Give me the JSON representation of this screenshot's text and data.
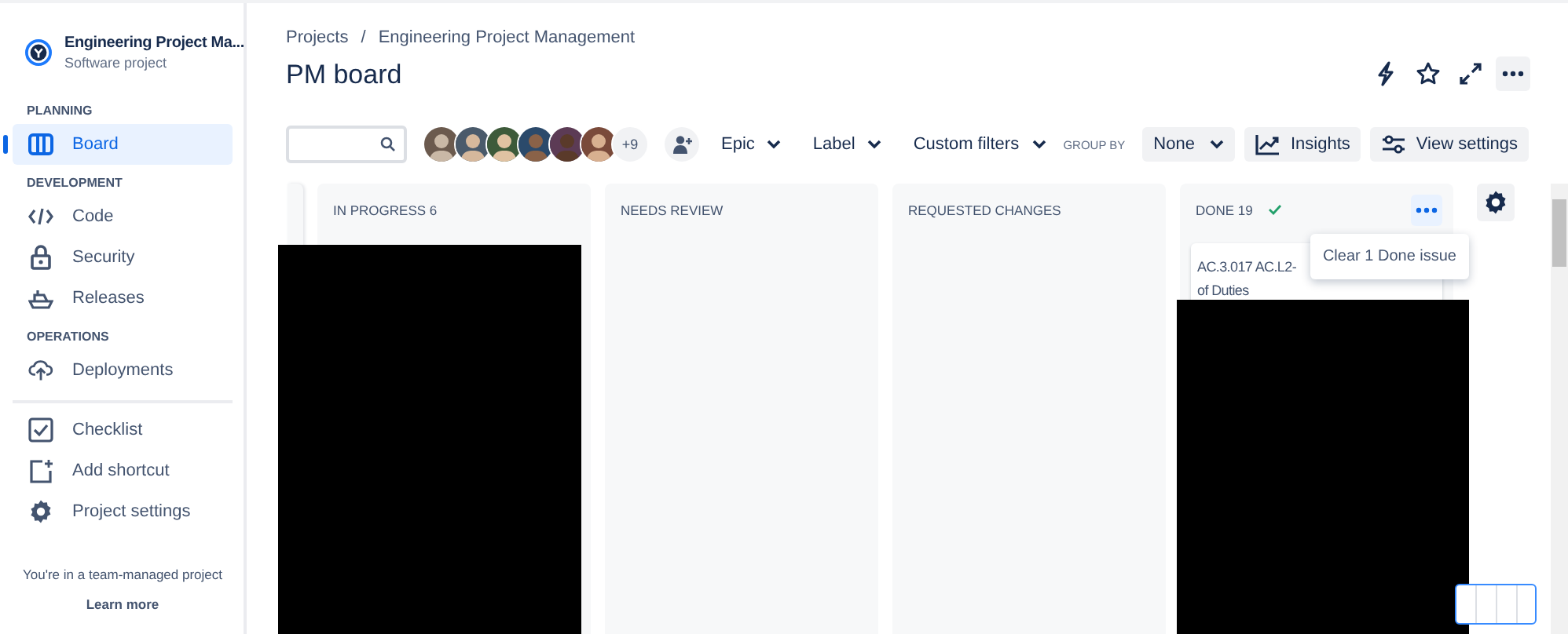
{
  "project": {
    "name": "Engineering Project Ma...",
    "type": "Software project"
  },
  "sidebar": {
    "sections": [
      {
        "heading": "PLANNING",
        "items": [
          {
            "label": "Board",
            "selected": true
          }
        ]
      },
      {
        "heading": "DEVELOPMENT",
        "items": [
          {
            "label": "Code",
            "selected": false
          },
          {
            "label": "Security",
            "selected": false
          },
          {
            "label": "Releases",
            "selected": false
          }
        ]
      },
      {
        "heading": "OPERATIONS",
        "items": [
          {
            "label": "Deployments",
            "selected": false
          }
        ]
      }
    ],
    "bottom_items": [
      {
        "label": "Checklist"
      },
      {
        "label": "Add shortcut"
      },
      {
        "label": "Project settings"
      }
    ],
    "footer": {
      "text": "You're in a team-managed project",
      "link": "Learn more"
    }
  },
  "breadcrumbs": {
    "items": [
      "Projects",
      "Engineering Project Management"
    ],
    "separator": "/"
  },
  "title": "PM board",
  "toolbar": {
    "avatars": [
      {
        "kind": "picture"
      },
      {
        "kind": "picture"
      },
      {
        "kind": "picture"
      },
      {
        "kind": "picture"
      },
      {
        "kind": "picture"
      },
      {
        "kind": "picture"
      }
    ],
    "more_count": "+9",
    "filters": [
      "Epic",
      "Label",
      "Custom filters"
    ],
    "group_by": {
      "label": "GROUP BY",
      "value": "None"
    },
    "buttons": [
      {
        "label": "Insights"
      },
      {
        "label": "View settings"
      }
    ]
  },
  "columns": [
    {
      "title": "IN PROGRESS 6",
      "done": false,
      "menu_open": false,
      "redacted": true
    },
    {
      "title": "NEEDS REVIEW",
      "done": false,
      "menu_open": false,
      "redacted": false
    },
    {
      "title": "REQUESTED CHANGES",
      "done": false,
      "menu_open": false,
      "redacted": false
    },
    {
      "title": "DONE 19",
      "done": true,
      "menu_open": true,
      "redacted": true,
      "cards": [
        {
          "lines": [
            "AC.3.017 AC.L2-",
            "of Duties"
          ]
        }
      ]
    }
  ],
  "column_menu": {
    "items": [
      "Clear 1 Done issue"
    ]
  }
}
